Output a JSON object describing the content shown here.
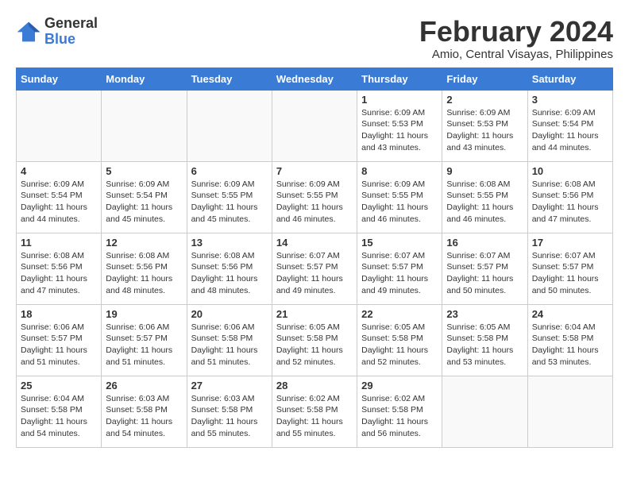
{
  "header": {
    "logo_general": "General",
    "logo_blue": "Blue",
    "month_title": "February 2024",
    "location": "Amio, Central Visayas, Philippines"
  },
  "days_of_week": [
    "Sunday",
    "Monday",
    "Tuesday",
    "Wednesday",
    "Thursday",
    "Friday",
    "Saturday"
  ],
  "weeks": [
    [
      {
        "day": "",
        "info": ""
      },
      {
        "day": "",
        "info": ""
      },
      {
        "day": "",
        "info": ""
      },
      {
        "day": "",
        "info": ""
      },
      {
        "day": "1",
        "info": "Sunrise: 6:09 AM\nSunset: 5:53 PM\nDaylight: 11 hours\nand 43 minutes."
      },
      {
        "day": "2",
        "info": "Sunrise: 6:09 AM\nSunset: 5:53 PM\nDaylight: 11 hours\nand 43 minutes."
      },
      {
        "day": "3",
        "info": "Sunrise: 6:09 AM\nSunset: 5:54 PM\nDaylight: 11 hours\nand 44 minutes."
      }
    ],
    [
      {
        "day": "4",
        "info": "Sunrise: 6:09 AM\nSunset: 5:54 PM\nDaylight: 11 hours\nand 44 minutes."
      },
      {
        "day": "5",
        "info": "Sunrise: 6:09 AM\nSunset: 5:54 PM\nDaylight: 11 hours\nand 45 minutes."
      },
      {
        "day": "6",
        "info": "Sunrise: 6:09 AM\nSunset: 5:55 PM\nDaylight: 11 hours\nand 45 minutes."
      },
      {
        "day": "7",
        "info": "Sunrise: 6:09 AM\nSunset: 5:55 PM\nDaylight: 11 hours\nand 46 minutes."
      },
      {
        "day": "8",
        "info": "Sunrise: 6:09 AM\nSunset: 5:55 PM\nDaylight: 11 hours\nand 46 minutes."
      },
      {
        "day": "9",
        "info": "Sunrise: 6:08 AM\nSunset: 5:55 PM\nDaylight: 11 hours\nand 46 minutes."
      },
      {
        "day": "10",
        "info": "Sunrise: 6:08 AM\nSunset: 5:56 PM\nDaylight: 11 hours\nand 47 minutes."
      }
    ],
    [
      {
        "day": "11",
        "info": "Sunrise: 6:08 AM\nSunset: 5:56 PM\nDaylight: 11 hours\nand 47 minutes."
      },
      {
        "day": "12",
        "info": "Sunrise: 6:08 AM\nSunset: 5:56 PM\nDaylight: 11 hours\nand 48 minutes."
      },
      {
        "day": "13",
        "info": "Sunrise: 6:08 AM\nSunset: 5:56 PM\nDaylight: 11 hours\nand 48 minutes."
      },
      {
        "day": "14",
        "info": "Sunrise: 6:07 AM\nSunset: 5:57 PM\nDaylight: 11 hours\nand 49 minutes."
      },
      {
        "day": "15",
        "info": "Sunrise: 6:07 AM\nSunset: 5:57 PM\nDaylight: 11 hours\nand 49 minutes."
      },
      {
        "day": "16",
        "info": "Sunrise: 6:07 AM\nSunset: 5:57 PM\nDaylight: 11 hours\nand 50 minutes."
      },
      {
        "day": "17",
        "info": "Sunrise: 6:07 AM\nSunset: 5:57 PM\nDaylight: 11 hours\nand 50 minutes."
      }
    ],
    [
      {
        "day": "18",
        "info": "Sunrise: 6:06 AM\nSunset: 5:57 PM\nDaylight: 11 hours\nand 51 minutes."
      },
      {
        "day": "19",
        "info": "Sunrise: 6:06 AM\nSunset: 5:57 PM\nDaylight: 11 hours\nand 51 minutes."
      },
      {
        "day": "20",
        "info": "Sunrise: 6:06 AM\nSunset: 5:58 PM\nDaylight: 11 hours\nand 51 minutes."
      },
      {
        "day": "21",
        "info": "Sunrise: 6:05 AM\nSunset: 5:58 PM\nDaylight: 11 hours\nand 52 minutes."
      },
      {
        "day": "22",
        "info": "Sunrise: 6:05 AM\nSunset: 5:58 PM\nDaylight: 11 hours\nand 52 minutes."
      },
      {
        "day": "23",
        "info": "Sunrise: 6:05 AM\nSunset: 5:58 PM\nDaylight: 11 hours\nand 53 minutes."
      },
      {
        "day": "24",
        "info": "Sunrise: 6:04 AM\nSunset: 5:58 PM\nDaylight: 11 hours\nand 53 minutes."
      }
    ],
    [
      {
        "day": "25",
        "info": "Sunrise: 6:04 AM\nSunset: 5:58 PM\nDaylight: 11 hours\nand 54 minutes."
      },
      {
        "day": "26",
        "info": "Sunrise: 6:03 AM\nSunset: 5:58 PM\nDaylight: 11 hours\nand 54 minutes."
      },
      {
        "day": "27",
        "info": "Sunrise: 6:03 AM\nSunset: 5:58 PM\nDaylight: 11 hours\nand 55 minutes."
      },
      {
        "day": "28",
        "info": "Sunrise: 6:02 AM\nSunset: 5:58 PM\nDaylight: 11 hours\nand 55 minutes."
      },
      {
        "day": "29",
        "info": "Sunrise: 6:02 AM\nSunset: 5:58 PM\nDaylight: 11 hours\nand 56 minutes."
      },
      {
        "day": "",
        "info": ""
      },
      {
        "day": "",
        "info": ""
      }
    ]
  ]
}
